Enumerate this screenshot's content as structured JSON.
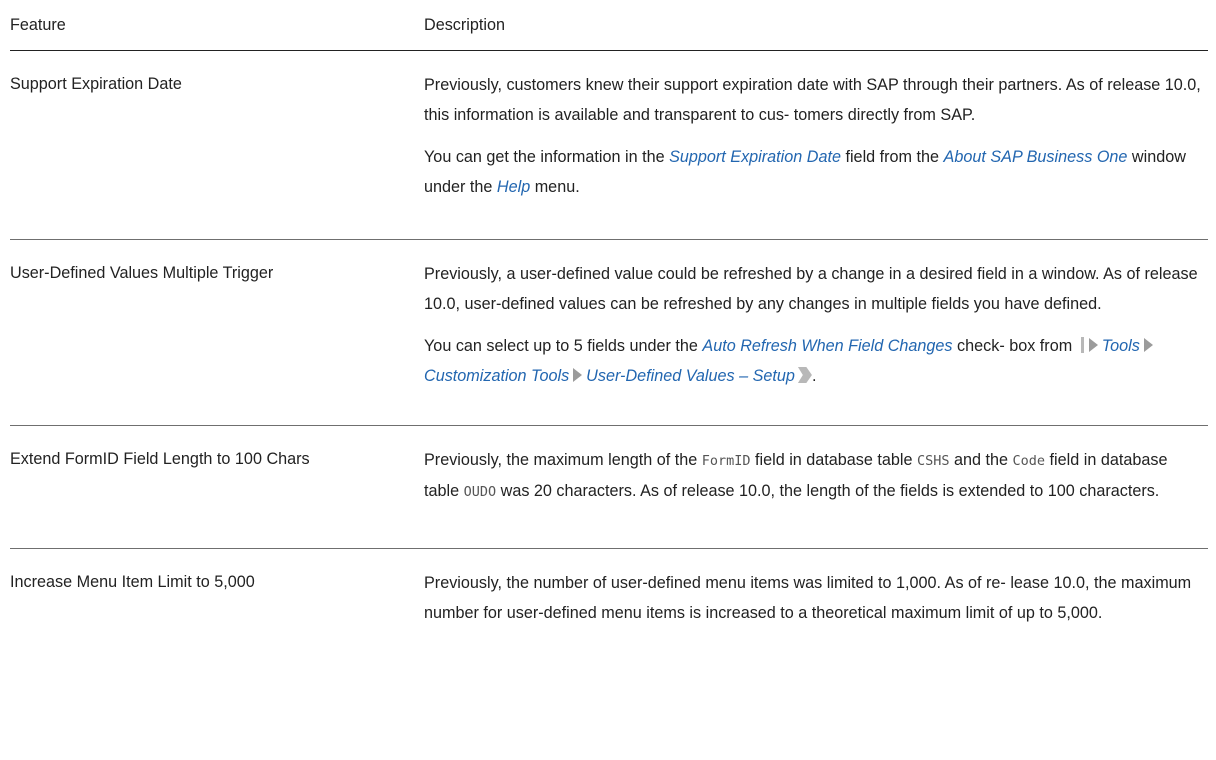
{
  "table": {
    "headers": {
      "feature": "Feature",
      "description": "Description"
    },
    "rows": [
      {
        "feature": "Support Expiration Date",
        "p1": "Previously, customers knew their support expiration date with SAP through their partners. As of release 10.0, this information is available and transparent to cus- tomers directly from SAP.",
        "p2": {
          "t1": "You can get the information in the ",
          "h1": "Support Expiration Date",
          "t2": " field from the ",
          "h2": "About SAP Business One",
          "t3": " window under the ",
          "h3": "Help",
          "t4": " menu."
        }
      },
      {
        "feature": "User-Defined Values Multiple Trigger",
        "p1": "Previously, a user-defined value could be refreshed by a change in a desired field in a window. As of release 10.0, user-defined values can be refreshed by any changes in multiple fields you have defined.",
        "p2": {
          "t1": "You can select up to 5 fields under the ",
          "h1": "Auto Refresh When Field Changes",
          "t2": " check- box from ",
          "path": [
            "Tools",
            "Customization Tools",
            "User-Defined Values – Setup"
          ],
          "t3": "."
        }
      },
      {
        "feature": "Extend FormID Field Length to 100 Chars",
        "p1": {
          "t1": "Previously, the maximum length of the ",
          "c1": "FormID",
          "t2": " field in database table ",
          "c2": "CSHS",
          "t3": " and the ",
          "c3": "Code",
          "t4": " field in database table ",
          "c4": "OUDO",
          "t5": " was 20 characters. As of release 10.0, the length of the fields is extended to 100 characters."
        }
      },
      {
        "feature": "Increase Menu Item Limit to 5,000",
        "p1": "Previously, the number of user-defined menu items was limited to 1,000. As of re- lease 10.0, the maximum number for user-defined menu items is increased to a theoretical maximum limit of up to 5,000."
      }
    ]
  }
}
